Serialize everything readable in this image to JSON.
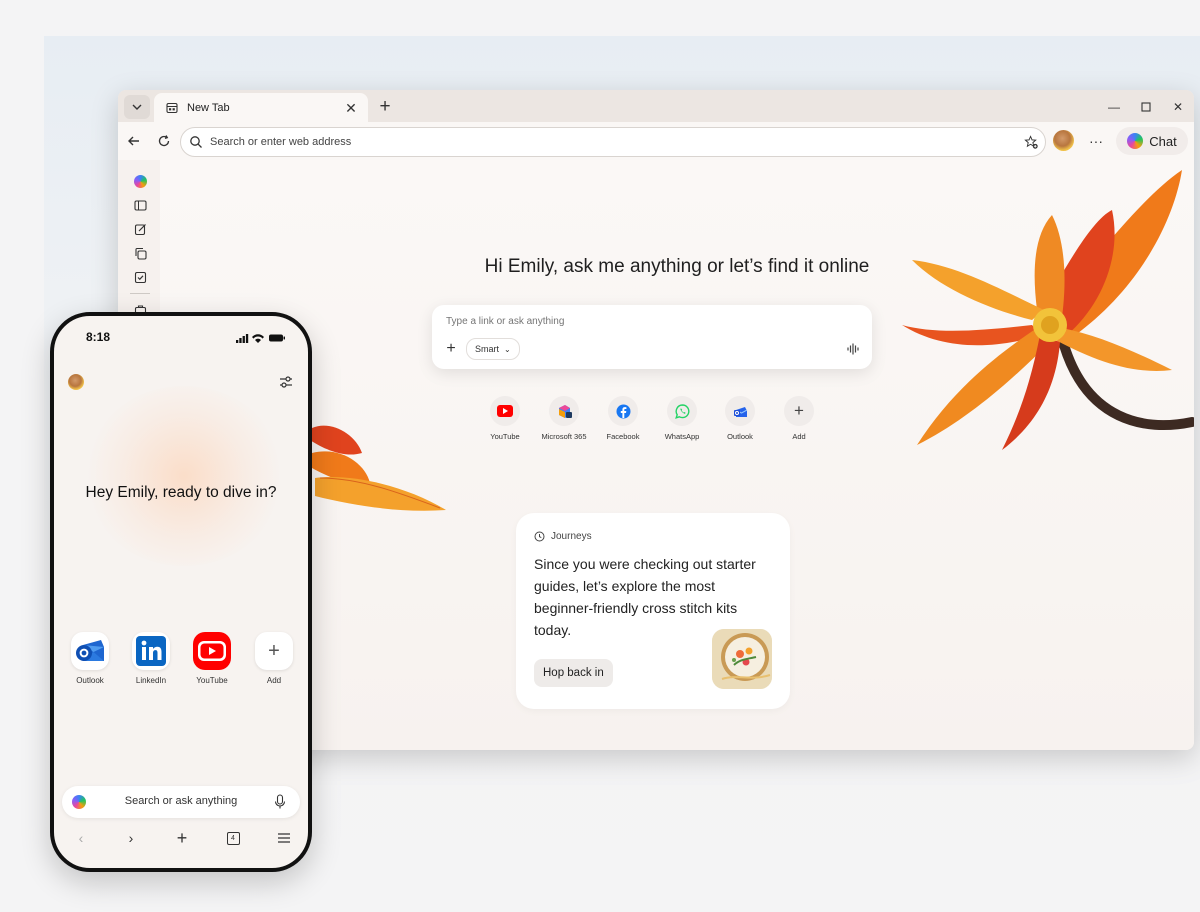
{
  "browser": {
    "tab": {
      "title": "New Tab"
    },
    "address_placeholder": "Search or enter web address",
    "chat_label": "Chat",
    "headline": "Hi Emily, ask me anything or let’s find it online",
    "ask_placeholder": "Type a link or ask anything",
    "smart_label": "Smart",
    "shortcuts": [
      {
        "label": "YouTube",
        "icon": "youtube-icon"
      },
      {
        "label": "Microsoft 365",
        "icon": "microsoft-365-icon"
      },
      {
        "label": "Facebook",
        "icon": "facebook-icon"
      },
      {
        "label": "WhatsApp",
        "icon": "whatsapp-icon"
      },
      {
        "label": "Outlook",
        "icon": "outlook-icon"
      },
      {
        "label": "Add",
        "icon": "plus-icon"
      }
    ],
    "journey": {
      "header": "Journeys",
      "text": "Since you were checking out starter guides, let’s explore the most beginner-friendly cross stitch kits today.",
      "button": "Hop back in"
    }
  },
  "phone": {
    "time": "8:18",
    "headline": "Hey Emily, ready to dive in?",
    "apps": [
      {
        "label": "Outlook",
        "icon": "outlook-icon"
      },
      {
        "label": "LinkedIn",
        "icon": "linkedin-icon"
      },
      {
        "label": "YouTube",
        "icon": "youtube-icon"
      },
      {
        "label": "Add",
        "icon": "plus-icon"
      }
    ],
    "tab_count": "4",
    "search_placeholder": "Search or ask anything"
  },
  "colors": {
    "accent_orange": "#f07a1a",
    "petal_red": "#e0431e",
    "youtube_red": "#ff0000",
    "linkedin_blue": "#0a66c2"
  }
}
